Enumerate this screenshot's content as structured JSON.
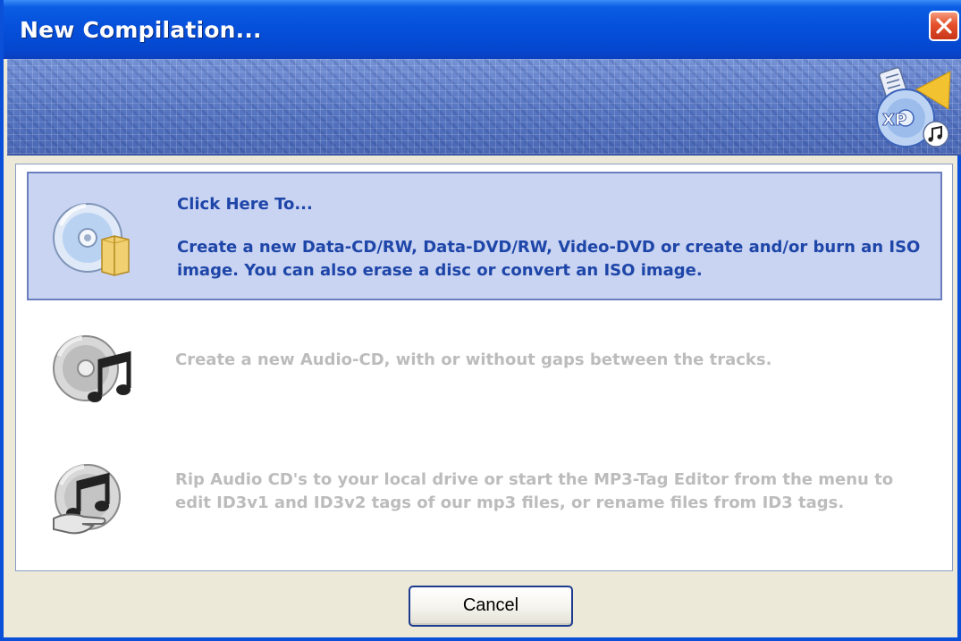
{
  "window": {
    "title": "New Compilation..."
  },
  "options": [
    {
      "heading": "Click Here To...",
      "description": "Create a new Data-CD/RW, Data-DVD/RW, Video-DVD or create and/or burn an ISO image. You can also erase a disc or convert an ISO image.",
      "icon": "data-disc-icon",
      "state": "selected"
    },
    {
      "description": "Create a new Audio-CD, with or without gaps between the tracks.",
      "icon": "audio-cd-icon",
      "state": "disabled"
    },
    {
      "description": "Rip Audio CD's to your local drive or start the MP3-Tag Editor from the menu to edit ID3v1 and ID3v2 tags of our mp3 files, or rename files from ID3 tags.",
      "icon": "rip-audio-icon",
      "state": "disabled"
    }
  ],
  "buttons": {
    "cancel_label": "Cancel"
  },
  "colors": {
    "titlebar": "#0550db",
    "selected_bg": "#c9d3f2",
    "selected_text": "#1e46a8",
    "disabled_text": "#bcbcbc"
  }
}
